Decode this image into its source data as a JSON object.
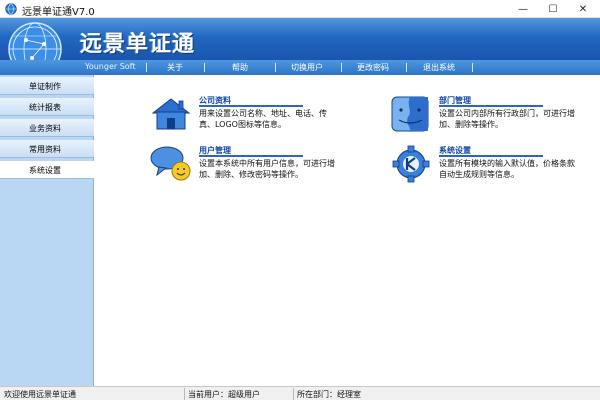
{
  "window": {
    "title": "远景单证通V7.0",
    "controls": {
      "minimize": "—",
      "maximize": "☐",
      "close": "✕"
    }
  },
  "banner": {
    "title": "远景单证通"
  },
  "menubar": {
    "brand": "Younger Soft",
    "items": [
      "关于",
      "帮助",
      "切换用户",
      "更改密码",
      "退出系统"
    ]
  },
  "sidebar": {
    "items": [
      {
        "label": "单证制作",
        "active": false
      },
      {
        "label": "统计报表",
        "active": false
      },
      {
        "label": "业务资料",
        "active": false
      },
      {
        "label": "常用资料",
        "active": false
      },
      {
        "label": "系统设置",
        "active": true
      }
    ]
  },
  "content": {
    "tiles": [
      {
        "icon": "house-icon",
        "title": "公司资料",
        "desc_lines": [
          "用来设置公司名称、地址、电话、传",
          "真、LOGO图标等信息。"
        ]
      },
      {
        "icon": "mac-finder-icon",
        "title": "部门管理",
        "desc_lines": [
          "设置公司内部所有行政部门，可进行增",
          "加、删除等操作。"
        ]
      },
      {
        "icon": "user-chat-icon",
        "title": "用户管理",
        "desc_lines": [
          "设置本系统中所有用户信息，可进行增",
          "加、删除、修改密码等操作。"
        ]
      },
      {
        "icon": "kde-gear-icon",
        "title": "系统设置",
        "desc_lines": [
          "设置所有模块的输入默认值，价格条款",
          "自动生成规则等信息。"
        ]
      }
    ]
  },
  "statusbar": {
    "welcome": "欢迎使用远景单证通",
    "current_user": "当前用户：超级用户",
    "department": "所在部门：经理室"
  },
  "colors": {
    "banner_blue": "#1f63be",
    "sidebar_bg": "#b9d7f3",
    "link_blue": "#1146a6"
  }
}
